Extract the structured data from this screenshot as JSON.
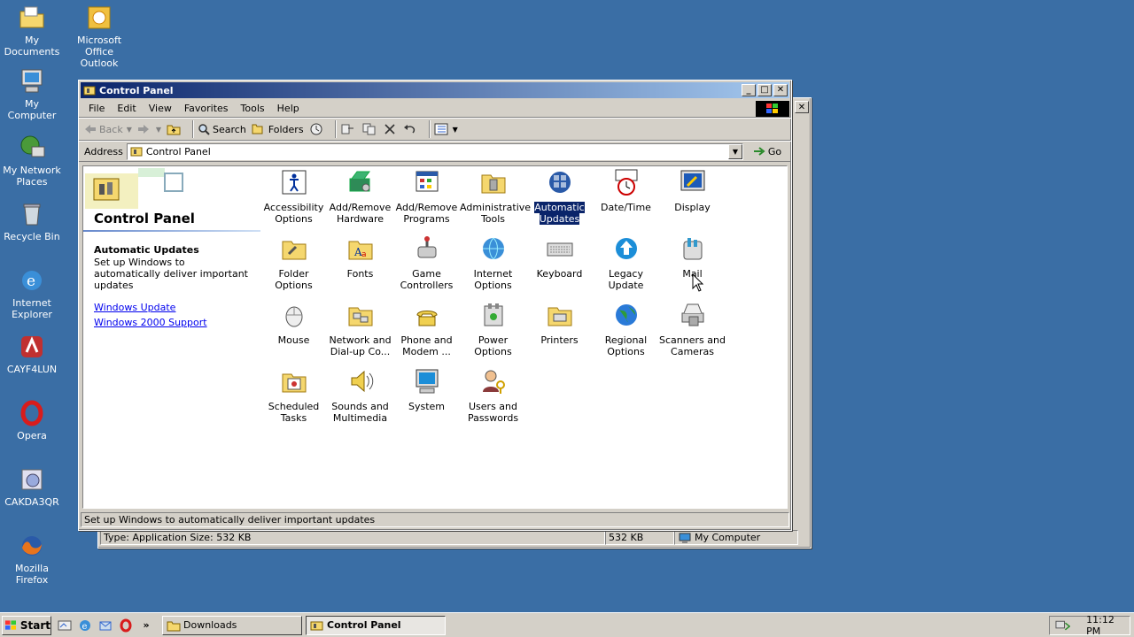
{
  "desktop": {
    "icons": [
      {
        "label": "My Documents"
      },
      {
        "label": "Microsoft Office Outlook"
      },
      {
        "label": "My Computer"
      },
      {
        "label": "My Network Places"
      },
      {
        "label": "Recycle Bin"
      },
      {
        "label": "Internet Explorer"
      },
      {
        "label": "CAYF4LUN"
      },
      {
        "label": "Opera"
      },
      {
        "label": "CAKDA3QR"
      },
      {
        "label": "Mozilla Firefox"
      }
    ]
  },
  "back_window": {
    "status_type": "Type: Application Size: 532 KB",
    "status_size": "532 KB",
    "status_zone": "My Computer"
  },
  "window": {
    "title": "Control Panel",
    "menu": [
      "File",
      "Edit",
      "View",
      "Favorites",
      "Tools",
      "Help"
    ],
    "toolbar": {
      "back": "Back",
      "search": "Search",
      "folders": "Folders"
    },
    "address_label": "Address",
    "address_value": "Control Panel",
    "go_label": "Go",
    "status": "Set up Windows to automatically deliver important updates"
  },
  "left_pane": {
    "title": "Control Panel",
    "info_title": "Automatic Updates",
    "info_text": "Set up Windows to automatically deliver important updates",
    "links": [
      "Windows Update",
      "Windows 2000 Support"
    ]
  },
  "items": [
    {
      "label": "Accessibility Options",
      "icon": "accessibility-icon"
    },
    {
      "label": "Add/Remove Hardware",
      "icon": "hardware-icon"
    },
    {
      "label": "Add/Remove Programs",
      "icon": "programs-icon"
    },
    {
      "label": "Administrative Tools",
      "icon": "admin-tools-icon"
    },
    {
      "label": "Automatic Updates",
      "icon": "automatic-updates-icon",
      "selected": true
    },
    {
      "label": "Date/Time",
      "icon": "datetime-icon"
    },
    {
      "label": "Display",
      "icon": "display-icon"
    },
    {
      "label": "Folder Options",
      "icon": "folder-options-icon"
    },
    {
      "label": "Fonts",
      "icon": "fonts-icon"
    },
    {
      "label": "Game Controllers",
      "icon": "game-controllers-icon"
    },
    {
      "label": "Internet Options",
      "icon": "internet-options-icon"
    },
    {
      "label": "Keyboard",
      "icon": "keyboard-icon"
    },
    {
      "label": "Legacy Update",
      "icon": "legacy-update-icon"
    },
    {
      "label": "Mail",
      "icon": "mail-icon"
    },
    {
      "label": "Mouse",
      "icon": "mouse-icon"
    },
    {
      "label": "Network and Dial-up Co...",
      "icon": "network-icon"
    },
    {
      "label": "Phone and Modem ...",
      "icon": "phone-icon"
    },
    {
      "label": "Power Options",
      "icon": "power-icon"
    },
    {
      "label": "Printers",
      "icon": "printers-icon"
    },
    {
      "label": "Regional Options",
      "icon": "regional-icon"
    },
    {
      "label": "Scanners and Cameras",
      "icon": "scanners-icon"
    },
    {
      "label": "Scheduled Tasks",
      "icon": "scheduled-tasks-icon"
    },
    {
      "label": "Sounds and Multimedia",
      "icon": "sounds-icon"
    },
    {
      "label": "System",
      "icon": "system-icon"
    },
    {
      "label": "Users and Passwords",
      "icon": "users-icon"
    }
  ],
  "taskbar": {
    "start": "Start",
    "tasks": [
      "Downloads",
      "Control Panel"
    ],
    "clock": "11:12 PM"
  },
  "colors": {
    "desktop": "#3a6ea5",
    "titlebar": "#0a246a",
    "selection": "#0a246a"
  }
}
